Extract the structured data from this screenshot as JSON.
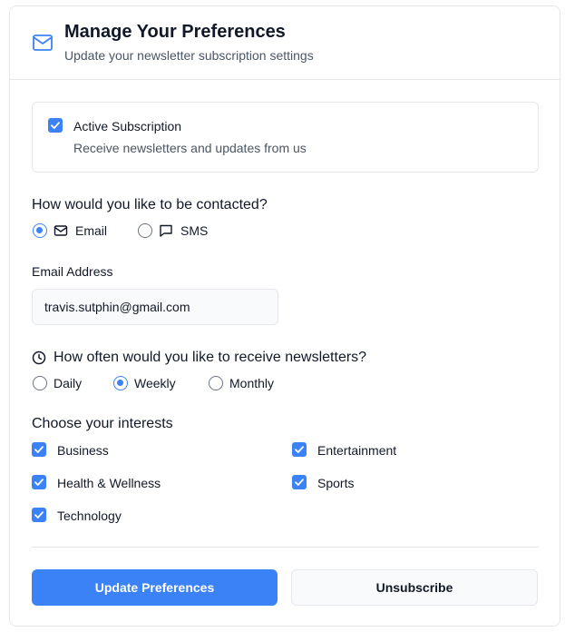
{
  "header": {
    "icon": "mail-icon",
    "title": "Manage Your Preferences",
    "subtitle": "Update your newsletter subscription settings"
  },
  "subscription": {
    "label": "Active Subscription",
    "description": "Receive newsletters and updates from us",
    "checked": true
  },
  "contact": {
    "question": "How would you like to be contacted?",
    "options": [
      {
        "label": "Email",
        "icon": "mail-icon",
        "selected": true
      },
      {
        "label": "SMS",
        "icon": "message-icon",
        "selected": false
      }
    ]
  },
  "email": {
    "label": "Email Address",
    "value": "travis.sutphin@gmail.com"
  },
  "frequency": {
    "icon": "clock-icon",
    "question": "How often would you like to receive newsletters?",
    "options": [
      {
        "label": "Daily",
        "selected": false
      },
      {
        "label": "Weekly",
        "selected": true
      },
      {
        "label": "Monthly",
        "selected": false
      }
    ]
  },
  "interests": {
    "title": "Choose your interests",
    "items": [
      {
        "label": "Business",
        "checked": true
      },
      {
        "label": "Entertainment",
        "checked": true
      },
      {
        "label": "Health & Wellness",
        "checked": true
      },
      {
        "label": "Sports",
        "checked": true
      },
      {
        "label": "Technology",
        "checked": true
      }
    ]
  },
  "actions": {
    "update_label": "Update Preferences",
    "unsubscribe_label": "Unsubscribe"
  },
  "colors": {
    "accent": "#3b82f6",
    "border": "#e5e7eb",
    "text": "#111827",
    "muted": "#4b5563"
  }
}
